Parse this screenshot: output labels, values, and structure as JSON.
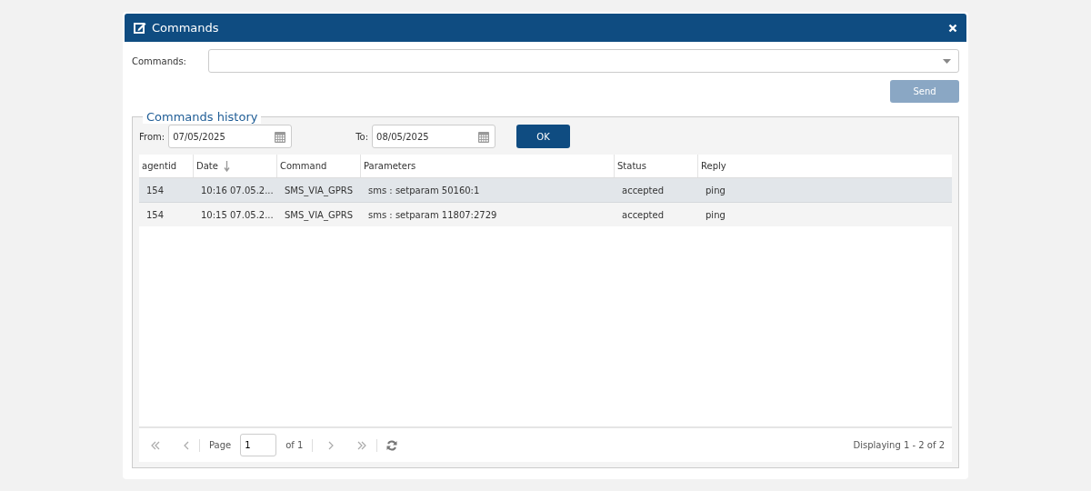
{
  "window": {
    "title": "Commands"
  },
  "command_field": {
    "label": "Commands:"
  },
  "send_button": {
    "label": "Send",
    "disabled": true
  },
  "history": {
    "legend": "Commands history",
    "from": {
      "label": "From:",
      "value": "07/05/2025"
    },
    "to": {
      "label": "To:",
      "value": "08/05/2025"
    },
    "ok_button": "OK",
    "columns": [
      {
        "label": "agentid",
        "sorted": false
      },
      {
        "label": "Date",
        "sorted": true
      },
      {
        "label": "Command",
        "sorted": false
      },
      {
        "label": "Parameters",
        "sorted": false
      },
      {
        "label": "Status",
        "sorted": false
      },
      {
        "label": "Reply",
        "sorted": false
      }
    ],
    "rows": [
      {
        "selected": true,
        "cells": [
          "154",
          "10:16 07.05.2...",
          "SMS_VIA_GPRS",
          "sms : setparam 50160:1",
          "accepted",
          "ping"
        ]
      },
      {
        "selected": false,
        "cells": [
          "154",
          "10:15 07.05.2...",
          "SMS_VIA_GPRS",
          "sms : setparam 11807:2729",
          "accepted",
          "ping"
        ]
      }
    ]
  },
  "pager": {
    "page_label": "Page",
    "page": "1",
    "of": "of 1",
    "summary": "Displaying 1 - 2 of 2"
  }
}
